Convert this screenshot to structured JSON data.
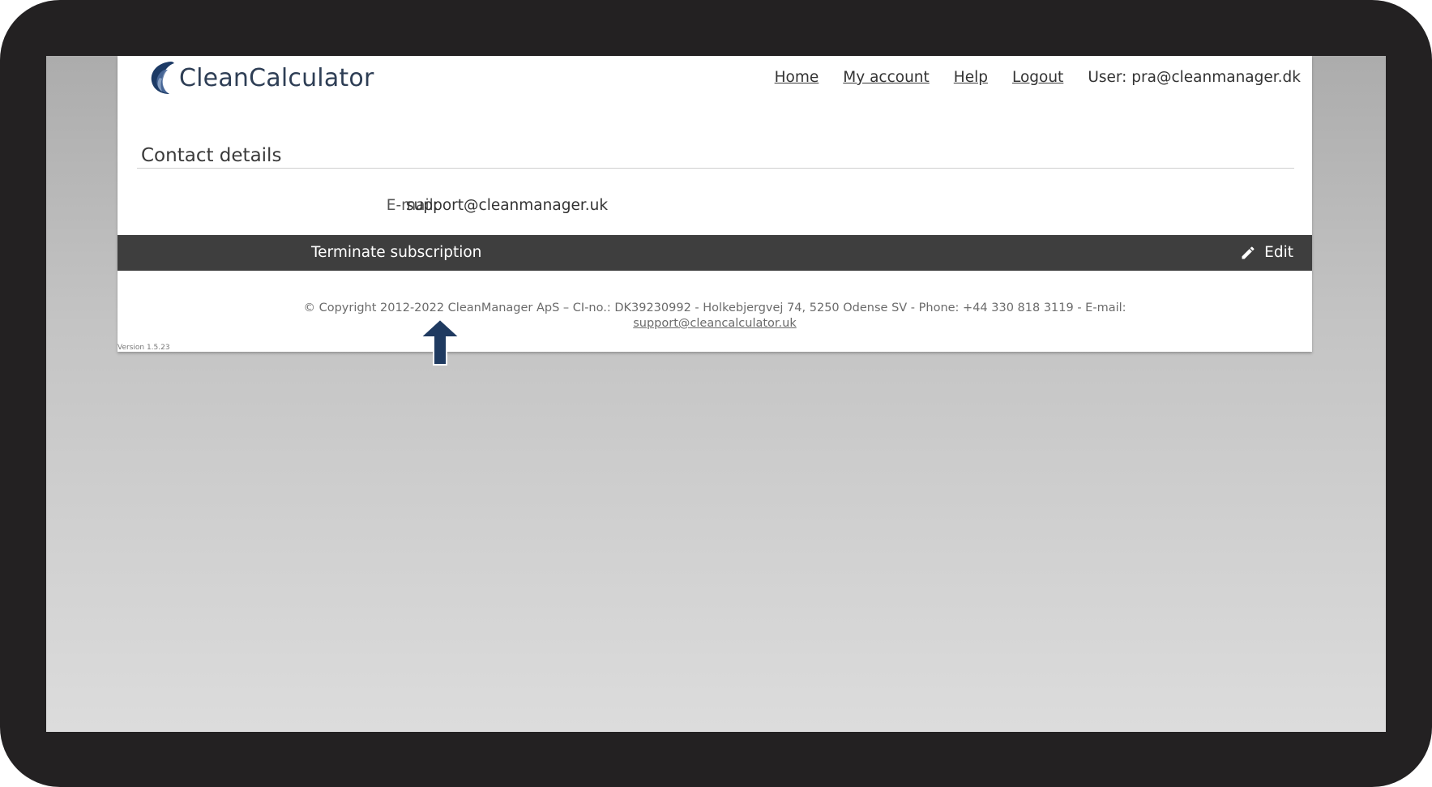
{
  "app": {
    "name": "CleanCalculator"
  },
  "nav": {
    "home": "Home",
    "my_account": "My account",
    "help": "Help",
    "logout": "Logout",
    "user": "User: pra@cleanmanager.dk"
  },
  "contact": {
    "title": "Contact details",
    "email_label": "E-mail:",
    "email_value": "support@cleanmanager.uk"
  },
  "actions": {
    "terminate": "Terminate subscription",
    "edit": "Edit"
  },
  "footer": {
    "text": "© Copyright 2012-2022 CleanManager ApS – CI-no.: DK39230992 - Holkebjergvej 74, 5250 Odense SV - Phone: +44 330 818 3119 - E-mail:",
    "email_link": "support@cleancalculator.uk",
    "version": "Version 1.5.23"
  },
  "colors": {
    "action_bar": "#3e3e3e",
    "logo_text": "#2e3e55",
    "logo_mark": "#1d3b66",
    "arrow": "#1f3a60",
    "device_frame": "#232122"
  },
  "icons": {
    "edit": "pencil-icon",
    "pointer": "arrow-up-icon"
  }
}
